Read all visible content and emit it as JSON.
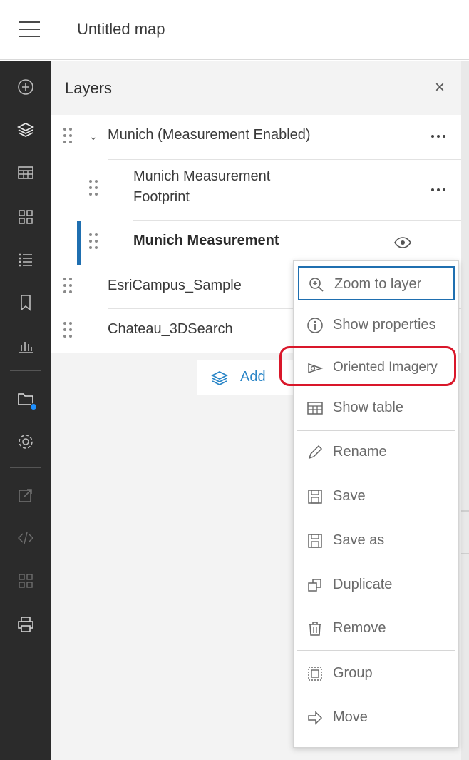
{
  "header": {
    "title": "Untitled map"
  },
  "panel": {
    "title": "Layers",
    "close": "×",
    "layers": [
      {
        "label": "Munich (Measurement Enabled)"
      },
      {
        "label_line1": "Munich Measurement",
        "label_line2": "Footprint"
      },
      {
        "label": "Munich Measurement"
      },
      {
        "label": "EsriCampus_Sample"
      },
      {
        "label": "Chateau_3DSearch"
      }
    ],
    "add_label": "Add"
  },
  "menu": {
    "items": [
      {
        "label": "Zoom to layer",
        "icon": "zoom-in-icon"
      },
      {
        "label": "Show properties",
        "icon": "info-icon"
      },
      {
        "label": "Oriented Imagery",
        "icon": "oriented-imagery-icon"
      },
      {
        "label": "Show table",
        "icon": "table-icon"
      },
      {
        "label": "Rename",
        "icon": "pencil-icon"
      },
      {
        "label": "Save",
        "icon": "save-icon"
      },
      {
        "label": "Save as",
        "icon": "save-as-icon"
      },
      {
        "label": "Duplicate",
        "icon": "duplicate-icon"
      },
      {
        "label": "Remove",
        "icon": "trash-icon"
      },
      {
        "label": "Group",
        "icon": "group-icon"
      },
      {
        "label": "Move",
        "icon": "arrow-right-icon"
      }
    ]
  },
  "colors": {
    "rail": "#2b2b2b",
    "accent": "#1f6fb0",
    "highlight": "#d9172a",
    "badge": "#1e90ff"
  }
}
